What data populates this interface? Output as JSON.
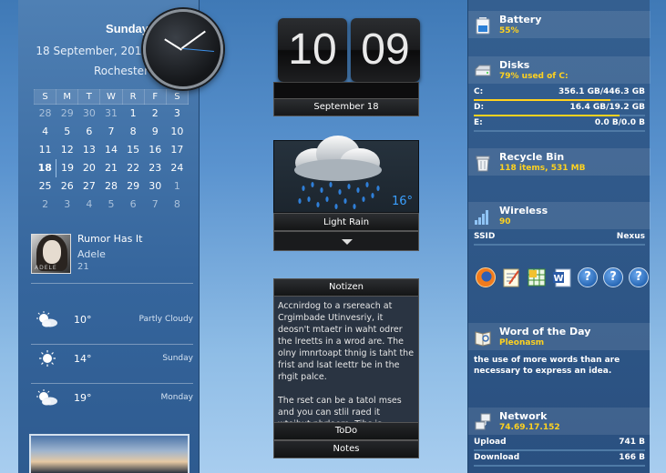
{
  "clock_panel": {
    "day": "Sunday",
    "date": "18 September, 2011",
    "city": "Rochester"
  },
  "calendar": {
    "weekdays": [
      "S",
      "M",
      "T",
      "W",
      "R",
      "F",
      "S"
    ],
    "weeks": [
      [
        "28",
        "29",
        "30",
        "31",
        "1",
        "2",
        "3"
      ],
      [
        "4",
        "5",
        "6",
        "7",
        "8",
        "9",
        "10"
      ],
      [
        "11",
        "12",
        "13",
        "14",
        "15",
        "16",
        "17"
      ],
      [
        "18",
        "19",
        "20",
        "21",
        "22",
        "23",
        "24"
      ],
      [
        "25",
        "26",
        "27",
        "28",
        "29",
        "30",
        "1"
      ],
      [
        "2",
        "3",
        "4",
        "5",
        "6",
        "7",
        "8"
      ]
    ]
  },
  "music": {
    "song": "Rumor Has It",
    "artist": "Adele",
    "album": "21",
    "cover_text": "ADELE"
  },
  "forecast": [
    {
      "temp": "10°",
      "desc": "Partly Cloudy",
      "icon": "partly-cloudy-icon"
    },
    {
      "temp": "14°",
      "desc": "Sunday",
      "icon": "sunny-icon"
    },
    {
      "temp": "19°",
      "desc": "Monday",
      "icon": "partly-cloudy-icon"
    }
  ],
  "flip_clock": {
    "hours": "10",
    "minutes": "09",
    "date": "September  18"
  },
  "weather": {
    "temp": "16°",
    "condition": "Light Rain"
  },
  "notes": {
    "title": "Notizen",
    "paragraphs": [
      "Accnirdog to a rsereach at Crgimbade Utinvesriy, it deosn't mtaetr in waht odrer the lreetts in a wrod are. The olny imnrtoapt thnig is taht the frist and lsat leettr be in the rhgit palce.",
      "The rset can be a tatol mses and you can stlil raed it wtoihut pbrloem. Tihs is bseacue the ha..."
    ],
    "tabs": [
      "ToDo",
      "Notes"
    ]
  },
  "battery": {
    "title": "Battery",
    "value": "55%"
  },
  "disks": {
    "title": "Disks",
    "summary": "79% used of C:",
    "drives": [
      {
        "label": "C:",
        "value": "356.1 GB/446.3 GB",
        "used_fraction": 0.8
      },
      {
        "label": "D:",
        "value": "16.4 GB/19.2 GB",
        "used_fraction": 0.85
      },
      {
        "label": "E:",
        "value": "0.0 B/0.0 B",
        "used_fraction": 0
      }
    ]
  },
  "recycle_bin": {
    "title": "Recycle Bin",
    "value": "118  items, 531 MB"
  },
  "wireless": {
    "title": "Wireless",
    "value": "90",
    "ssid_label": "SSID",
    "ssid": "Nexus"
  },
  "launcher": {
    "icons": [
      "firefox-icon",
      "notepad-icon",
      "spreadsheet-icon",
      "word-icon",
      "help-icon",
      "help-icon",
      "help-icon"
    ],
    "help_glyph": "?"
  },
  "word_of_day": {
    "title": "Word of the Day",
    "word": "Pleonasm",
    "definition": "the use of more words than are necessary to express an idea."
  },
  "network": {
    "title": "Network",
    "ip": "74.69.17.152",
    "rows": [
      {
        "label": "Upload",
        "value": "741 B"
      },
      {
        "label": "Download",
        "value": "166 B"
      }
    ]
  }
}
